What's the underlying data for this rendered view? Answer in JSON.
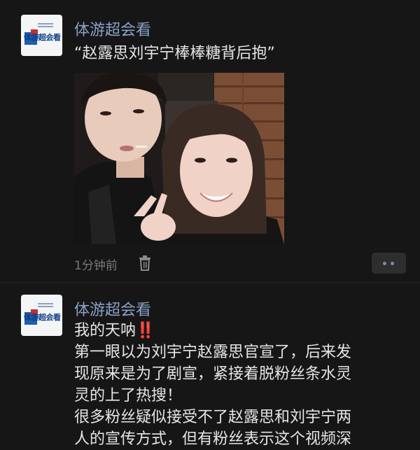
{
  "posts": [
    {
      "author": "体游超会看",
      "avatar_text": "体游超会看",
      "text": "“赵露思刘宇宁棒棒糖背后抱”",
      "time": "1分钟前"
    },
    {
      "author": "体游超会看",
      "avatar_text": "体游超会看",
      "lines": [
        "我的天呐",
        "第一眼以为刘宇宁赵露思官宣了，后来发",
        "现原来是为了剧宣，紧接着脱粉丝条水灵",
        "灵的上了热搜！",
        "很多粉丝疑似接受不了赵露思和刘宇宁两",
        "人的宣传方式，但有粉丝表示这个视频深"
      ],
      "emphasis": "‼️"
    }
  ],
  "colors": {
    "background": "#161616",
    "nickname": "#8aa3c9",
    "text": "#e6e6e6",
    "meta": "#7a7a7a"
  },
  "icons": {
    "delete": "trash-icon",
    "more": "more-dots-icon"
  }
}
